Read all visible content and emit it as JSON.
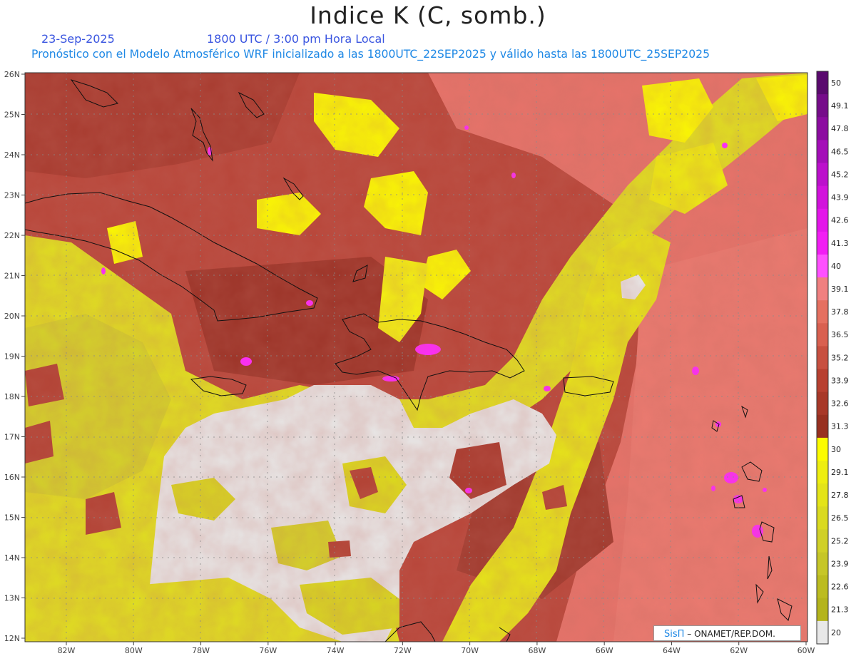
{
  "title": "Indice K (C, somb.)",
  "header": {
    "date": "23-Sep-2025",
    "time": "1800 UTC / 3:00 pm Hora Local",
    "description": "Pronóstico con el Modelo Atmosférico WRF inicializado a las 1800UTC_22SEP2025 y válido hasta las  1800UTC_25SEP2025"
  },
  "axes": {
    "lat_labels": [
      "26N",
      "25N",
      "24N",
      "23N",
      "22N",
      "21N",
      "20N",
      "19N",
      "18N",
      "17N",
      "16N",
      "15N",
      "14N",
      "13N",
      "12N"
    ],
    "lon_labels": [
      "82W",
      "80W",
      "78W",
      "76W",
      "74W",
      "72W",
      "70W",
      "68W",
      "66W",
      "64W",
      "62W",
      "60W"
    ]
  },
  "colorbar": {
    "levels": [
      "50",
      "49.1",
      "47.8",
      "46.5",
      "45.2",
      "43.9",
      "42.6",
      "41.3",
      "40",
      "39.1",
      "37.8",
      "36.5",
      "35.2",
      "33.9",
      "32.6",
      "31.3",
      "30",
      "29.1",
      "27.8",
      "26.5",
      "25.2",
      "23.9",
      "22.6",
      "21.3",
      "20"
    ],
    "colors": [
      "#5a0a6e",
      "#760c8a",
      "#8c0ca0",
      "#a40eb8",
      "#bc10cc",
      "#d212dc",
      "#e416ea",
      "#f21ef4",
      "#ff50ff",
      "#f08080",
      "#e57060",
      "#d96050",
      "#c85040",
      "#b84030",
      "#a83828",
      "#983020",
      "#fcfc00",
      "#eeee10",
      "#e4e418",
      "#dada20",
      "#d0d028",
      "#c6c628",
      "#bcbc20",
      "#b4b41c",
      "#e8e8e8"
    ]
  },
  "credit": {
    "brand": "SisΠ",
    "text": "– ONAMET/REP.DOM."
  }
}
